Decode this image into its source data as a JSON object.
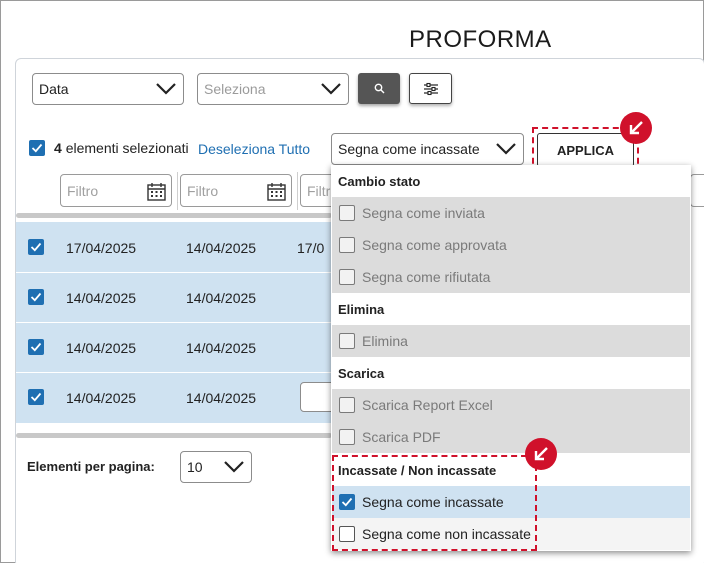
{
  "page": {
    "title": "PROFORMA"
  },
  "toolbar": {
    "field_select": "Data",
    "value_select_placeholder": "Seleziona",
    "search_icon": "search-icon",
    "filter_icon": "sliders-icon"
  },
  "selection_bar": {
    "count": "4",
    "count_label": "elementi selezionati",
    "deselect_label": "Deseleziona Tutto",
    "action_select": "Segna come incassate",
    "apply_label": "APPLICA"
  },
  "filters": [
    {
      "placeholder": "Filtro"
    },
    {
      "placeholder": "Filtro"
    },
    {
      "placeholder": "Filtr"
    }
  ],
  "table": {
    "rows": [
      {
        "selected": true,
        "col1": "17/04/2025",
        "col2": "14/04/2025",
        "col3": "17/0"
      },
      {
        "selected": true,
        "col1": "14/04/2025",
        "col2": "14/04/2025",
        "col3": ""
      },
      {
        "selected": true,
        "col1": "14/04/2025",
        "col2": "14/04/2025",
        "col3": ""
      },
      {
        "selected": true,
        "col1": "14/04/2025",
        "col2": "14/04/2025",
        "col3": ""
      }
    ]
  },
  "pagination": {
    "label": "Elementi per pagina:",
    "value": "10"
  },
  "dropdown": {
    "groups": [
      {
        "header": "Cambio stato",
        "items": [
          {
            "label": "Segna come inviata",
            "state": "disabled"
          },
          {
            "label": "Segna come approvata",
            "state": "disabled"
          },
          {
            "label": "Segna come rifiutata",
            "state": "disabled"
          }
        ]
      },
      {
        "header": "Elimina",
        "items": [
          {
            "label": "Elimina",
            "state": "disabled"
          }
        ]
      },
      {
        "header": "Scarica",
        "items": [
          {
            "label": "Scarica Report Excel",
            "state": "disabled"
          },
          {
            "label": "Scarica PDF",
            "state": "disabled"
          }
        ]
      },
      {
        "header": "Incassate / Non incassate",
        "items": [
          {
            "label": "Segna come incassate",
            "state": "selected"
          },
          {
            "label": "Segna come non incassate",
            "state": "normal"
          }
        ]
      }
    ]
  },
  "colors": {
    "accent": "#1f6fb2",
    "highlight": "#d0112b",
    "row_selected": "#cfe2f1"
  }
}
